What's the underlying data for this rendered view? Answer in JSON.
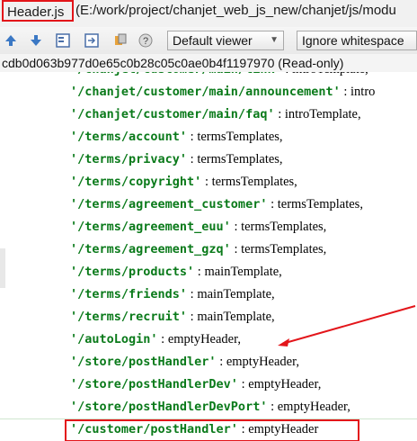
{
  "window": {
    "file_name": "Header.js",
    "file_path": "(E:/work/project/chanjet_web_js_new/chanjet/js/modu"
  },
  "toolbar": {
    "viewer_select": "Default viewer",
    "whitespace_select": "Ignore whitespace",
    "icons": [
      "up-arrow-icon",
      "down-arrow-icon",
      "left-panel-icon",
      "right-panel-icon",
      "settings-icon",
      "help-icon"
    ]
  },
  "revision": "cdb0d063b977d0e65c0b28c05c0ae0b4f1197970 (Read-only)",
  "code": {
    "lines": [
      {
        "str": "'/chanjet/customer/main/link'",
        "rest": " : introTemplate,"
      },
      {
        "str": "'/chanjet/customer/main/announcement'",
        "rest": " : intro"
      },
      {
        "str": "'/chanjet/customer/main/faq'",
        "rest": " : introTemplate,"
      },
      {
        "str": "'/terms/account'",
        "rest": " : termsTemplates,"
      },
      {
        "str": "'/terms/privacy'",
        "rest": " : termsTemplates,"
      },
      {
        "str": "'/terms/copyright'",
        "rest": " : termsTemplates,"
      },
      {
        "str": "'/terms/agreement_customer'",
        "rest": " : termsTemplates,"
      },
      {
        "str": "'/terms/agreement_euu'",
        "rest": " : termsTemplates,"
      },
      {
        "str": "'/terms/agreement_gzq'",
        "rest": " : termsTemplates,"
      },
      {
        "str": "'/terms/products'",
        "rest": " : mainTemplate,"
      },
      {
        "str": "'/terms/friends'",
        "rest": " : mainTemplate,"
      },
      {
        "str": "'/terms/recruit'",
        "rest": " : mainTemplate,"
      },
      {
        "str": "'/autoLogin'",
        "rest": " : emptyHeader,"
      },
      {
        "str": "'/store/postHandler'",
        "rest": " : emptyHeader,"
      },
      {
        "str": "'/store/postHandlerDev'",
        "rest": " : emptyHeader,"
      },
      {
        "str": "'/store/postHandlerDevPort'",
        "rest": " : emptyHeader,"
      },
      {
        "str": "'/customer/postHandler'",
        "rest": " : emptyHeader"
      }
    ]
  },
  "colors": {
    "string": "#0a7a1a",
    "highlight": "#e3151a"
  }
}
